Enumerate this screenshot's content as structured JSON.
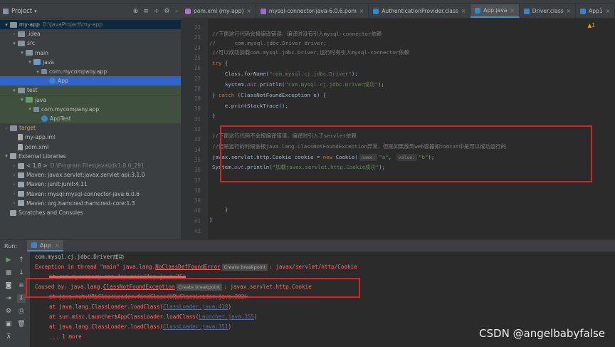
{
  "project": {
    "title": "Project",
    "tree": [
      {
        "label": "my-app",
        "dim": "D:\\JavaProject\\my-app",
        "indent": 0,
        "icon": "folder",
        "arrow": "open"
      },
      {
        "label": ".idea",
        "indent": 1,
        "icon": "folder",
        "arrow": "closed"
      },
      {
        "label": "src",
        "indent": 1,
        "icon": "folder",
        "arrow": "open"
      },
      {
        "label": "main",
        "indent": 2,
        "icon": "folder",
        "arrow": "open"
      },
      {
        "label": "java",
        "indent": 3,
        "icon": "src",
        "arrow": "open"
      },
      {
        "label": "com.mycompany.app",
        "indent": 4,
        "icon": "pkg",
        "arrow": "open"
      },
      {
        "label": "App",
        "indent": 5,
        "icon": "cls",
        "arrow": ""
      },
      {
        "label": "test",
        "indent": 1,
        "icon": "folder",
        "arrow": "open"
      },
      {
        "label": "java",
        "indent": 2,
        "icon": "test",
        "arrow": "open"
      },
      {
        "label": "com.mycompany.app",
        "indent": 3,
        "icon": "pkg",
        "arrow": "open"
      },
      {
        "label": "AppTest",
        "indent": 4,
        "icon": "cls",
        "arrow": ""
      },
      {
        "label": "target",
        "indent": 0,
        "icon": "folder",
        "arrow": "closed"
      },
      {
        "label": "my-app.iml",
        "indent": 1,
        "icon": "file",
        "arrow": ""
      },
      {
        "label": "pom.xml",
        "indent": 1,
        "icon": "file",
        "arrow": ""
      },
      {
        "label": "External Libraries",
        "indent": 0,
        "icon": "lib",
        "arrow": "open"
      },
      {
        "label": "< 1.8 >",
        "dim": "D:\\Program Files\\Java\\jdk1.8.0_291",
        "indent": 1,
        "icon": "lib",
        "arrow": "closed"
      },
      {
        "label": "Maven: javax.servlet:javax.servlet-api:3.1.0",
        "indent": 1,
        "icon": "lib",
        "arrow": "closed"
      },
      {
        "label": "Maven: junit:junit:4.11",
        "indent": 1,
        "icon": "lib",
        "arrow": "closed"
      },
      {
        "label": "Maven: mysql:mysql-connector-java:6.0.6",
        "indent": 1,
        "icon": "lib",
        "arrow": "closed"
      },
      {
        "label": "Maven: org.hamcrest:hamcrest-core:1.3",
        "indent": 1,
        "icon": "lib",
        "arrow": "closed"
      },
      {
        "label": "Scratches and Consoles",
        "indent": 0,
        "icon": "lib",
        "arrow": ""
      }
    ]
  },
  "editor": {
    "tabs": [
      {
        "label": "pom.xml (my-app)",
        "color": "#b06fc6"
      },
      {
        "label": "mysql-connector-java-6.0.6.pom",
        "color": "#9a6fc6"
      },
      {
        "label": "AuthenticationProvider.class",
        "color": "#3d84c6"
      },
      {
        "label": "App.java",
        "color": "#3d84c6"
      },
      {
        "label": "Driver.class",
        "color": "#3d84c6"
      },
      {
        "label": "App1",
        "color": "#3d84c6"
      }
    ],
    "warning": "▲1",
    "line_numbers": [
      "22",
      "23",
      "24",
      "25",
      "26",
      "27",
      "28",
      "29",
      "30",
      "31",
      "32",
      "33",
      "34",
      "35",
      "36",
      "37",
      "38",
      "39",
      "40",
      "41",
      "42"
    ],
    "lines": {
      "l22": "//下面这行代码会报编译错误，编译时没有引入mysql-connector依赖",
      "l23_prefix": "//",
      "l23": "com.mysql.jdbc.Driver driver;",
      "l24": "//可以成功加载com.mysql.jdbc.Driver,运行时有引入mysql-connector依赖",
      "l25_kw": "try",
      "l26_cls": "Class.",
      "l26_meth": "forName",
      "l26_str": "\"com.mysql.cj.jdbc.Driver\"",
      "l27_sys": "System.",
      "l27_out": "out",
      "l27_str": "\"com.mysql.cj.jdbc.Driver成功\"",
      "l28_kw": "catch",
      "l28_rest": "(ClassNotFoundException e) {",
      "l29": "e.printStackTrace();",
      "l33": "//下面这行代码不会报编译错误，编译时引入了servlet依赖",
      "l34": "//但是运行的时候会报java.lang.ClassNotFoundException异常，但是如果放到web容器如tomcat中是可以成功运行的",
      "l35_type": "javax.servlet.http.Cookie",
      "l35_var": "cookie",
      "l35_new": "new",
      "l35_ctor": "Cookie(",
      "l35_hint1": "name:",
      "l35_s1": "\"a\"",
      "l35_hint2": "value:",
      "l35_s2": "\"b\"",
      "l36_str": "\"加载javax.servlet.http.Cookie成功\""
    }
  },
  "run": {
    "label": "Run:",
    "tab": "App",
    "output": {
      "o1": "com.mysql.cj.jdbc.Driver成功",
      "o2a": "Exception in thread \"main\" java.lang.",
      "o2b": "NoClassDefFoundError",
      "o2c": "Create breakpoint",
      "o2d": ": javax/servlet/http/Cookie",
      "o3": "at com.mycompany.app.App.main(App.java:35)",
      "o4a": "Caused by: java.lang.",
      "o4b": "ClassNotFoundException",
      "o4c": "Create breakpoint",
      "o4d": ": javax.servlet.http.Cookie",
      "o5": "at java.net.URLClassLoader.findClass(URLClassLoader.java:382)",
      "o6a": "at java.lang.ClassLoader.loadClass(",
      "o6b": "ClassLoader.java:418",
      "o7a": "at sun.misc.Launcher$AppClassLoader.loadClass(",
      "o7b": "Launcher.java:355",
      "o8a": "at java.lang.ClassLoader.loadClass(",
      "o8b": "ClassLoader.java:351",
      "o9": "... 1 more",
      "close": ")"
    }
  },
  "watermark": "CSDN @angelbabyfalse"
}
